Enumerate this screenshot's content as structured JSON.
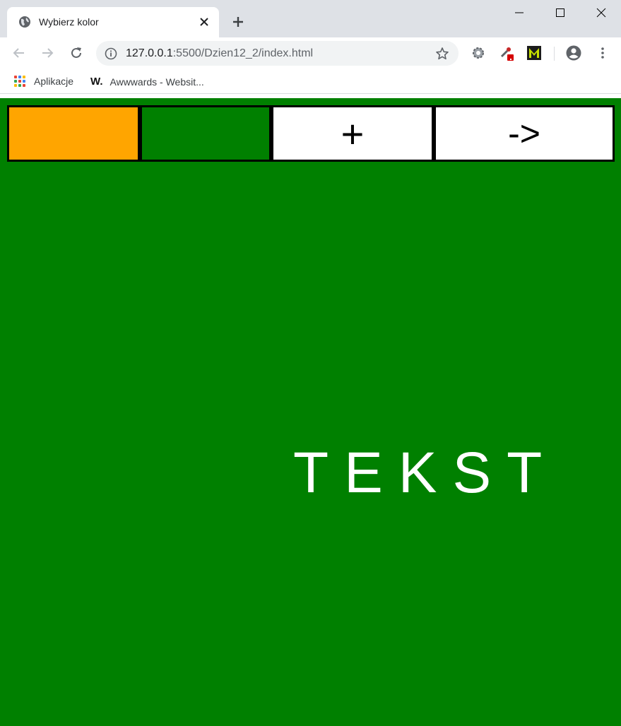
{
  "browser": {
    "tab_title": "Wybierz kolor",
    "url_host": "127.0.0.1",
    "url_rest": ":5500/Dzien12_2/index.html",
    "bookmarks": [
      {
        "label": "Aplikacje",
        "icon": "apps-grid-icon"
      },
      {
        "label": "Awwwards - Websit...",
        "icon": "awwwards-w-icon"
      }
    ]
  },
  "page": {
    "background": "#008000",
    "buttons": [
      {
        "label": "",
        "color": "#ffa500"
      },
      {
        "label": "",
        "color": "#008000"
      },
      {
        "label": "+",
        "color": "#ffffff"
      },
      {
        "label": "->",
        "color": "#ffffff"
      }
    ],
    "text": "TEKST",
    "text_color": "#ffffff"
  }
}
